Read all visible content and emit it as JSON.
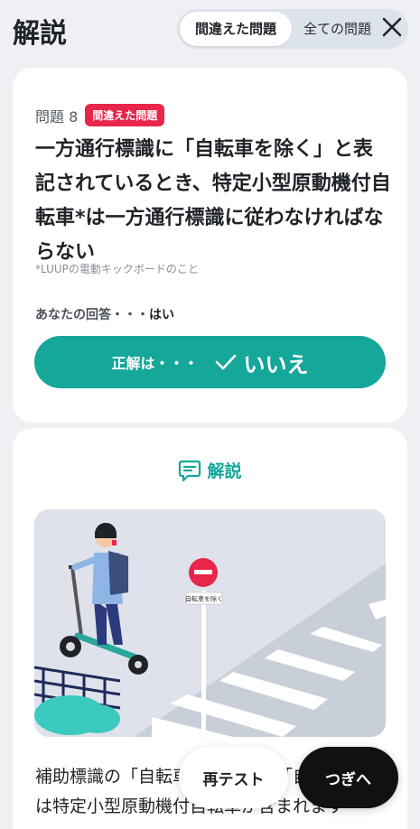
{
  "header": {
    "title": "解説",
    "tabs": [
      {
        "label": "間違えた問題",
        "active": true
      },
      {
        "label": "全ての問題",
        "active": false
      }
    ],
    "close_icon": "close-icon"
  },
  "question": {
    "number_label": "問題 8",
    "badge": "間違えた問題",
    "text": "一方通行標識に「自転車を除く」と表記されているとき、特定小型原動機付自転車*は一方通行標識に従わなければならない",
    "note": "*LUUPの電動キックボードのこと",
    "your_answer_label": "あなたの回答・・・",
    "your_answer_value": "はい",
    "correct_prefix": "正解は・・・",
    "correct_value": "いいえ"
  },
  "explanation": {
    "heading": "解説",
    "heading_icon": "comment-icon",
    "sign_text": "自転車を除く",
    "text": "補助標識の「自転車を除く」の「自転車」には特定小型原動機付自転車が含まれます"
  },
  "actions": {
    "retest_label": "再テスト",
    "next_label": "つぎへ"
  },
  "colors": {
    "accent": "#14a79a",
    "badge": "#e8254a",
    "background": "#eef0f3"
  }
}
